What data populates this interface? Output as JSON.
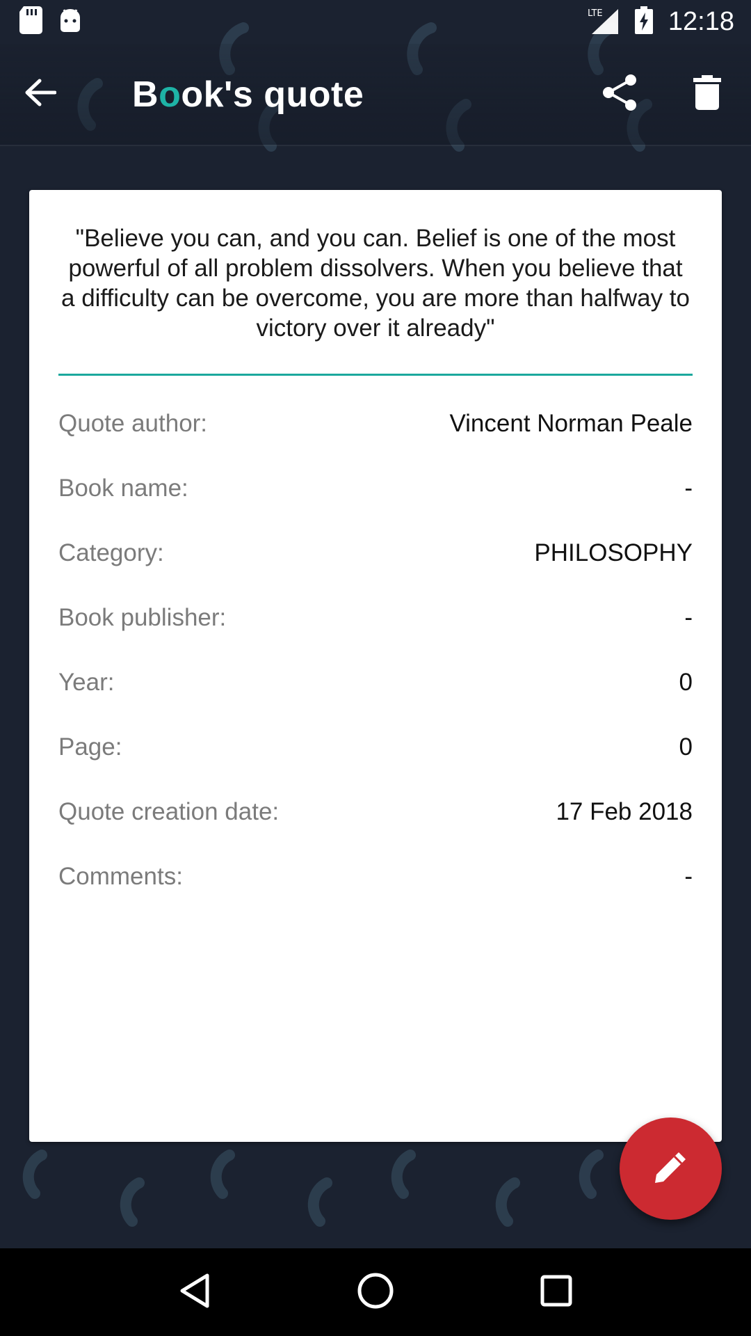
{
  "status_bar": {
    "time": "12:18",
    "network": "LTE",
    "icons": [
      "sd-card-icon",
      "android-icon",
      "signal-icon",
      "battery-charging-icon"
    ]
  },
  "toolbar": {
    "title_first": "B",
    "title_highlight": "o",
    "title_rest": "ok's quote",
    "back_icon": "arrow-back-icon",
    "share_icon": "share-icon",
    "delete_icon": "trash-icon"
  },
  "quote": {
    "text": "\"Believe you can, and you can. Belief is one of the most powerful of all problem dissolvers. When you believe that a difficulty can be overcome, you are more than halfway to victory over it already\""
  },
  "details": [
    {
      "label": "Quote author:",
      "value": "Vincent Norman Peale"
    },
    {
      "label": "Book name:",
      "value": "-"
    },
    {
      "label": "Category:",
      "value": "PHILOSOPHY"
    },
    {
      "label": "Book publisher:",
      "value": "-"
    },
    {
      "label": "Year:",
      "value": "0"
    },
    {
      "label": "Page:",
      "value": "0"
    },
    {
      "label": "Quote creation date:",
      "value": "17 Feb 2018"
    },
    {
      "label": "Comments:",
      "value": "-"
    }
  ],
  "fab": {
    "icon": "pencil-icon"
  },
  "nav_bar": {
    "icons": [
      "nav-back-icon",
      "nav-home-icon",
      "nav-recents-icon"
    ]
  },
  "colors": {
    "accent": "#1eb3a6",
    "fab": "#cc2a31",
    "background": "#1b2230",
    "card": "#ffffff"
  }
}
